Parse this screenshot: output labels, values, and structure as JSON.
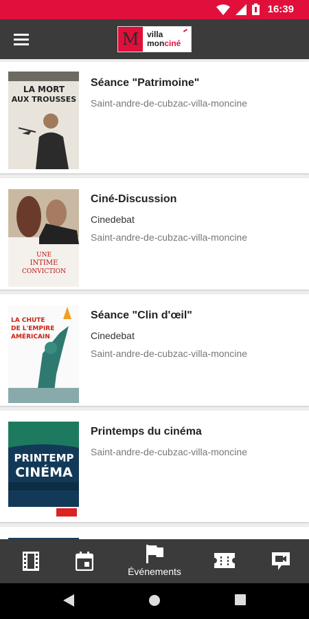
{
  "status_bar": {
    "time": "16:39",
    "icons": [
      "wifi-icon",
      "signal-icon",
      "battery-icon"
    ],
    "color": "#e0103a"
  },
  "app_bar": {
    "menu_icon": "hamburger-menu-icon",
    "logo": {
      "mark": "M",
      "line1": "villa",
      "line2a": "mon",
      "line2b": "ciné"
    }
  },
  "events": [
    {
      "title": "Séance \"Patrimoine\"",
      "subtitle": "",
      "venue": "Saint-andre-de-cubzac-villa-moncine",
      "poster_text": "LA MORT AUX TROUSSES"
    },
    {
      "title": "Ciné-Discussion",
      "subtitle": "Cinedebat",
      "venue": "Saint-andre-de-cubzac-villa-moncine",
      "poster_text": "UNE INTIME CONVICTION"
    },
    {
      "title": "Séance \"Clin d'œil\"",
      "subtitle": "Cinedebat",
      "venue": "Saint-andre-de-cubzac-villa-moncine",
      "poster_text": "LA CHUTE DE L'EMPIRE AMÉRICAIN"
    },
    {
      "title": "Printemps du cinéma",
      "subtitle": "",
      "venue": "Saint-andre-de-cubzac-villa-moncine",
      "poster_text": "PRINTEMPS CINÉMA"
    }
  ],
  "bottom_nav": {
    "items": [
      {
        "icon": "film-icon",
        "label": ""
      },
      {
        "icon": "calendar-icon",
        "label": ""
      },
      {
        "icon": "flag-icon",
        "label": "Événements",
        "active": true
      },
      {
        "icon": "ticket-icon",
        "label": ""
      },
      {
        "icon": "video-chat-icon",
        "label": ""
      }
    ]
  },
  "system_nav": [
    "back-icon",
    "home-icon",
    "recents-icon"
  ]
}
